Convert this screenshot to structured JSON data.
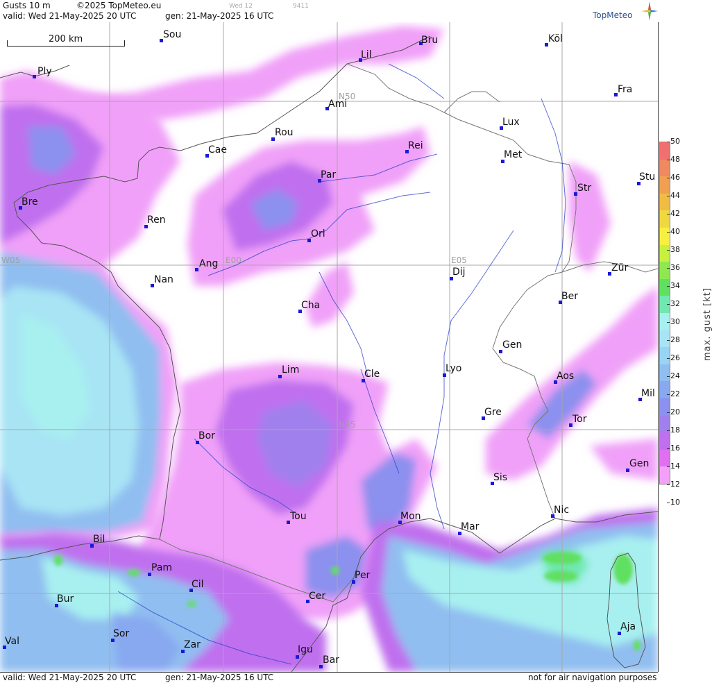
{
  "header": {
    "product": "Gusts 10 m",
    "copyright": "©2025 TopMeteo.eu",
    "run_label": "Wed 12",
    "code": "9411",
    "valid": "valid:  Wed  21-May-2025  20 UTC",
    "gen": "gen: 21-May-2025 16 UTC",
    "brand": "TopMeteo"
  },
  "scale_bar": {
    "label": "200 km"
  },
  "grid_labels": [
    "N50",
    "W05",
    "E00",
    "E05",
    "N45"
  ],
  "cities": [
    "Sou",
    "Bru",
    "Köl",
    "Lil",
    "Ply",
    "Fra",
    "Ami",
    "Lux",
    "Rou",
    "Cae",
    "Rei",
    "Met",
    "Par",
    "Bre",
    "Stu",
    "Str",
    "Ren",
    "Orl",
    "Ang",
    "Nan",
    "Dij",
    "Zür",
    "Ber",
    "Cha",
    "Gen",
    "Lim",
    "Cle",
    "Lyo",
    "Aos",
    "Mil",
    "Gre",
    "Tor",
    "Bor",
    "Gen",
    "Sis",
    "Nic",
    "Tou",
    "Mon",
    "Mar",
    "Bil",
    "Pam",
    "Per",
    "Cil",
    "Bur",
    "Cer",
    "Sor",
    "Ajа",
    "Val",
    "Zar",
    "Igu",
    "Bar"
  ],
  "legend": {
    "title": "max. gust  [kt]",
    "ticks": [
      "50",
      "48",
      "46",
      "44",
      "42",
      "40",
      "38",
      "36",
      "34",
      "32",
      "30",
      "28",
      "26",
      "24",
      "22",
      "20",
      "18",
      "16",
      "14",
      "12",
      "10"
    ],
    "colors": [
      "#f07070",
      "#f08860",
      "#f0a050",
      "#f0bc44",
      "#f0d840",
      "#f8f040",
      "#c8f040",
      "#90e850",
      "#60e060",
      "#70e8b0",
      "#a8f0f0",
      "#a8e4f4",
      "#98d4f4",
      "#90bef0",
      "#88a8f0",
      "#8c90ee",
      "#a080ec",
      "#c070ee",
      "#e070f0",
      "#f4a0f8"
    ]
  },
  "footer": {
    "valid": "valid:  Wed  21-May-2025  20 UTC",
    "gen": "gen: 21-May-2025 16 UTC",
    "note": "not for air navigation purposes"
  }
}
